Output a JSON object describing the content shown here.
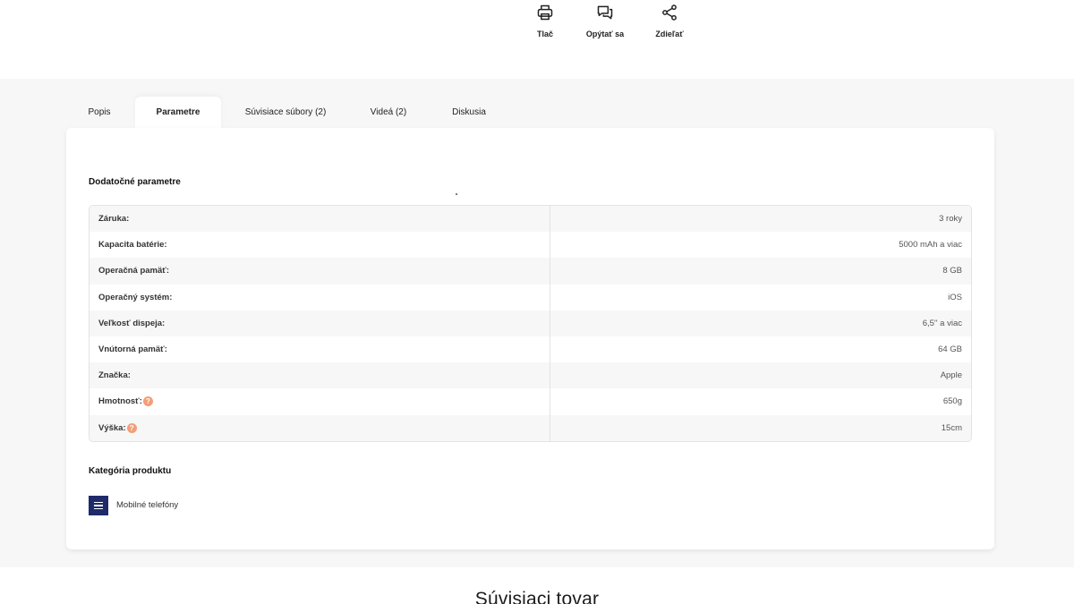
{
  "actions": {
    "print": "Tlač",
    "ask": "Opýtať sa",
    "share": "Zdieľať"
  },
  "tabs": [
    {
      "label": "Popis"
    },
    {
      "label": "Parametre"
    },
    {
      "label": "Súvisiace súbory (2)"
    },
    {
      "label": "Videá (2)"
    },
    {
      "label": "Diskusia"
    }
  ],
  "active_tab": "Parametre",
  "params": {
    "title": "Dodatočné parametre",
    "rows": [
      {
        "key": "Záruka:",
        "value": "3 roky"
      },
      {
        "key": "Kapacita batérie:",
        "value": "5000 mAh a viac"
      },
      {
        "key": "Operačná pamäť:",
        "value": "8 GB"
      },
      {
        "key": "Operačný systém:",
        "value": "iOS"
      },
      {
        "key": "Veľkosť dispeja:",
        "value": "6,5'' a viac"
      },
      {
        "key": "Vnútorná pamäť:",
        "value": "64 GB"
      },
      {
        "key": "Značka:",
        "value": "Apple"
      },
      {
        "key": "Hmotnosť:",
        "value": "650g",
        "help": "?"
      },
      {
        "key": "Výška:",
        "value": "15cm",
        "help": "?"
      }
    ]
  },
  "category": {
    "title": "Kategória produktu",
    "item": "Mobilné telefóny"
  },
  "related_title": "Súvisiaci tovar",
  "colors": {
    "accent_navy": "#1f2a6b",
    "help_badge": "#f39e77",
    "band_gray": "#f7f7f7"
  }
}
